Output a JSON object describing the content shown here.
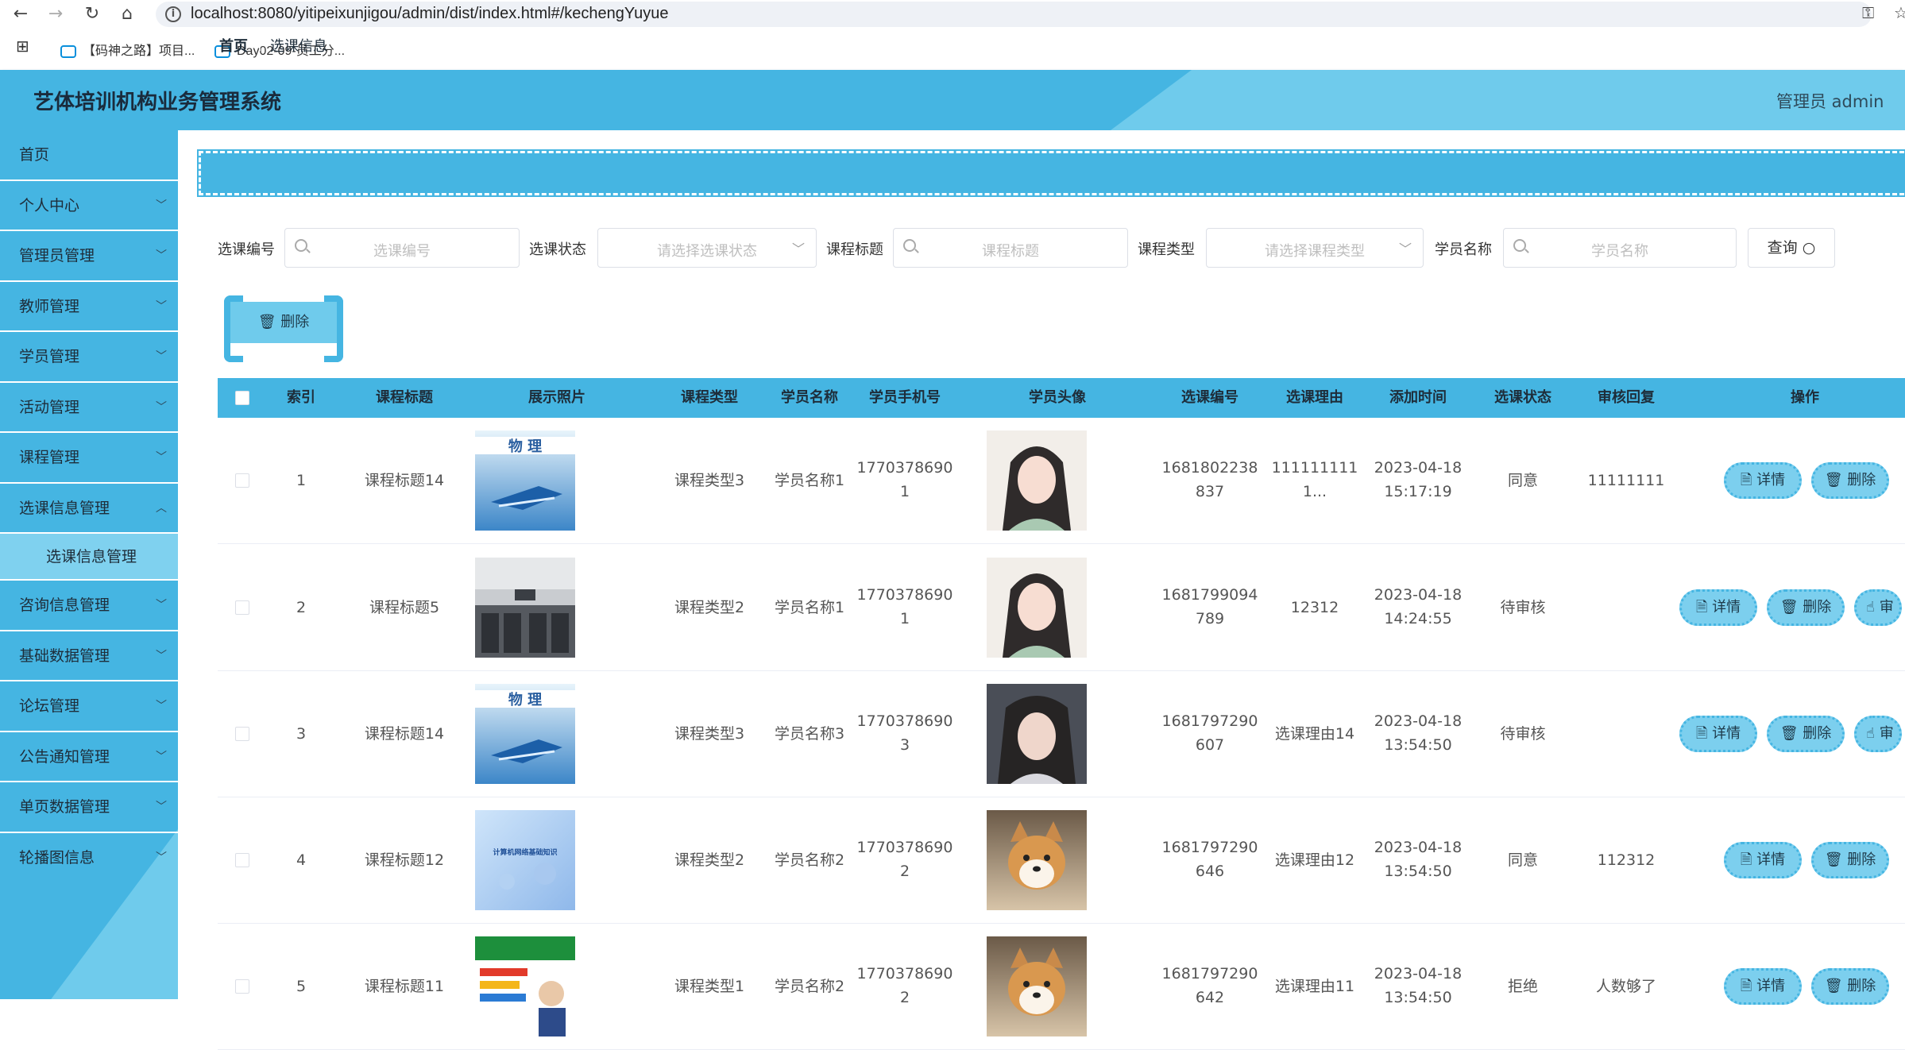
{
  "browser": {
    "url": "localhost:8080/yitipeixunjigou/admin/dist/index.html#/kechengYuyue",
    "bookmarks": [
      "【码神之路】项目...",
      "Day02-09-员工分..."
    ]
  },
  "header": {
    "title": "艺体培训机构业务管理系统",
    "user": "管理员 admin"
  },
  "sidebar": {
    "items": [
      {
        "label": "首页"
      },
      {
        "label": "个人中心"
      },
      {
        "label": "管理员管理"
      },
      {
        "label": "教师管理"
      },
      {
        "label": "学员管理"
      },
      {
        "label": "活动管理"
      },
      {
        "label": "课程管理"
      },
      {
        "label": "选课信息管理"
      },
      {
        "label": "选课信息管理"
      },
      {
        "label": "咨询信息管理"
      },
      {
        "label": "基础数据管理"
      },
      {
        "label": "论坛管理"
      },
      {
        "label": "公告通知管理"
      },
      {
        "label": "单页数据管理"
      },
      {
        "label": "轮播图信息"
      }
    ]
  },
  "breadcrumb": {
    "home": "首页",
    "current": "选课信息"
  },
  "search": {
    "f1_label": "选课编号",
    "f1_ph": "选课编号",
    "f2_label": "选课状态",
    "f2_ph": "请选择选课状态",
    "f3_label": "课程标题",
    "f3_ph": "课程标题",
    "f4_label": "课程类型",
    "f4_ph": "请选择课程类型",
    "f5_label": "学员名称",
    "f5_ph": "学员名称",
    "query": "查询"
  },
  "actions": {
    "batch_delete": "删除"
  },
  "table": {
    "headers": [
      "索引",
      "课程标题",
      "展示照片",
      "课程类型",
      "学员名称",
      "学员手机号",
      "学员头像",
      "选课编号",
      "选课理由",
      "添加时间",
      "选课状态",
      "审核回复",
      "操作"
    ],
    "rows": [
      {
        "idx": "1",
        "title": "课程标题14",
        "photo": "physics-book",
        "type": "课程类型3",
        "student": "学员名称1",
        "phone1": "1770378690",
        "phone2": "1",
        "avatar": "anime-girl",
        "no1": "1681802238",
        "no2": "837",
        "reason1": "111111111",
        "reason2": "1...",
        "date": "2023-04-18",
        "time": "15:17:19",
        "status": "同意",
        "reply": "11111111"
      },
      {
        "idx": "2",
        "title": "课程标题5",
        "photo": "classroom",
        "type": "课程类型2",
        "student": "学员名称1",
        "phone1": "1770378690",
        "phone2": "1",
        "avatar": "anime-girl",
        "no1": "1681799094",
        "no2": "789",
        "reason1": "12312",
        "reason2": "",
        "date": "2023-04-18",
        "time": "14:24:55",
        "status": "待审核",
        "reply": ""
      },
      {
        "idx": "3",
        "title": "课程标题14",
        "photo": "physics-book",
        "type": "课程类型3",
        "student": "学员名称3",
        "phone1": "1770378690",
        "phone2": "3",
        "avatar": "girl-photo",
        "no1": "1681797290",
        "no2": "607",
        "reason1": "选课理由14",
        "reason2": "",
        "date": "2023-04-18",
        "time": "13:54:50",
        "status": "待审核",
        "reply": ""
      },
      {
        "idx": "4",
        "title": "课程标题12",
        "photo": "network-book",
        "type": "课程类型2",
        "student": "学员名称2",
        "phone1": "1770378690",
        "phone2": "2",
        "avatar": "shiba-dog",
        "no1": "1681797290",
        "no2": "646",
        "reason1": "选课理由12",
        "reason2": "",
        "date": "2023-04-18",
        "time": "13:54:50",
        "status": "同意",
        "reply": "112312"
      },
      {
        "idx": "5",
        "title": "课程标题11",
        "photo": "teacher-poster",
        "type": "课程类型1",
        "student": "学员名称2",
        "phone1": "1770378690",
        "phone2": "2",
        "avatar": "shiba-dog",
        "no1": "1681797290",
        "no2": "642",
        "reason1": "选课理由11",
        "reason2": "",
        "date": "2023-04-18",
        "time": "13:54:50",
        "status": "拒绝",
        "reply": "人数够了"
      }
    ],
    "btn_detail": "详情",
    "btn_delete": "删除",
    "btn_review": "审"
  },
  "colors": {
    "primary": "#45b5e2",
    "light": "#6fcbec",
    "button": "#7ccfee"
  }
}
